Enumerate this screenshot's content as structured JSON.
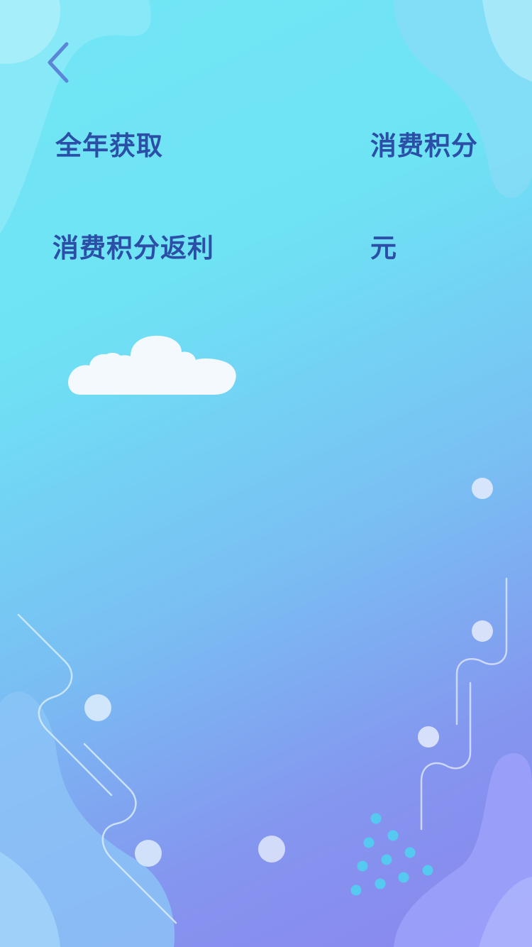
{
  "header": {
    "back_icon": "chevron-left-icon"
  },
  "summary": {
    "rows": [
      {
        "label": "全年获取",
        "value": "消费积分"
      },
      {
        "label": "消费积分返利",
        "value": "元"
      }
    ]
  },
  "colors": {
    "text": "#2b4fa6",
    "gradient_start": "#6ee3f4",
    "gradient_end": "#8b86ee",
    "dot_accent": "#55c9ef"
  },
  "decorations": {
    "cloud_icon": "cloud-icon"
  }
}
